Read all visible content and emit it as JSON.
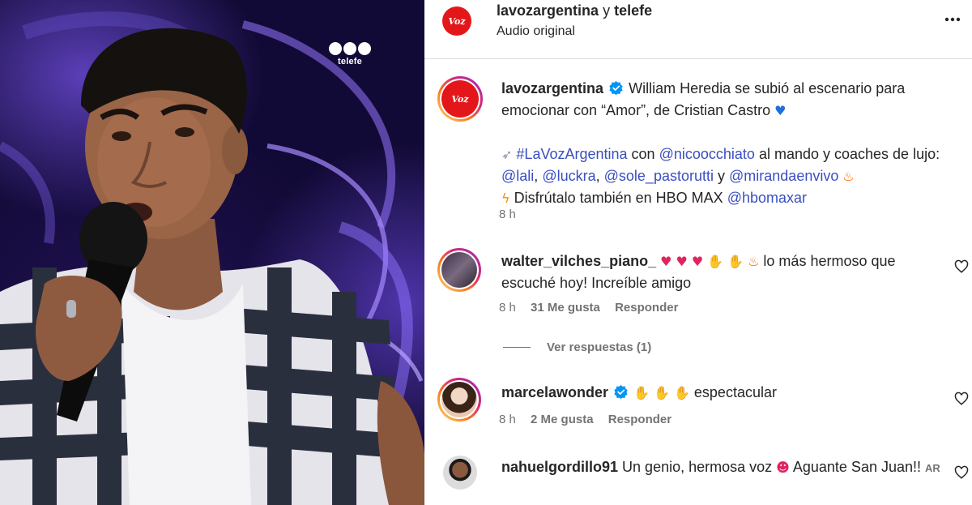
{
  "media": {
    "channel_logo_text": "telefe"
  },
  "header": {
    "account": "lavozargentina",
    "joiner": "y",
    "collaborator": "telefe",
    "audio_label": "Audio original",
    "more_icon": "more-horizontal-icon"
  },
  "caption": {
    "username": "lavozargentina",
    "verified": true,
    "line1": "William Heredia se subió al escenario para emocionar con “Amor”, de Cristian Castro",
    "line1_emoji": "blue-heart",
    "p2_rocket": "rocket",
    "hashtag": "#LaVozArgentina",
    "word_con": "con",
    "host": "@nicoocchiato",
    "p2_text": "al mando y coaches de lujo:",
    "coach1": "@lali",
    "comma1": ",",
    "coach2": "@luckra",
    "comma2": ",",
    "coach3": "@sole_pastorutti",
    "word_y": "y",
    "coach4": "@mirandaenvivo",
    "p2_emoji": "fire",
    "p3_emoji": "zap",
    "p3_text": "Disfrútalo también en HBO MAX",
    "p3_link": "@hbomaxar",
    "time": "8 h"
  },
  "comments": [
    {
      "username": "walter_vilches_piano_",
      "emojis": [
        "heart",
        "heart",
        "heart",
        "raised-hands",
        "raised-hands",
        "fire"
      ],
      "text": "lo más hermoso que escuché hoy! Increíble amigo",
      "time": "8 h",
      "likes": "31 Me gusta",
      "reply_label": "Responder",
      "view_replies": "Ver respuestas (1)"
    },
    {
      "username": "marcelawonder",
      "verified": true,
      "emojis": [
        "clap",
        "clap",
        "clap"
      ],
      "text": "espectacular",
      "time": "8 h",
      "likes": "2 Me gusta",
      "reply_label": "Responder"
    },
    {
      "username": "nahuelgordillo91",
      "text_before": "Un genio, hermosa voz",
      "emoji": "heart-eyes",
      "text_after": "Aguante San Juan!!",
      "badge": "AR"
    }
  ],
  "colors": {
    "link": "#3a4fbf",
    "muted": "#737373",
    "verified": "#0095f6",
    "brand_red": "#e3171a"
  }
}
